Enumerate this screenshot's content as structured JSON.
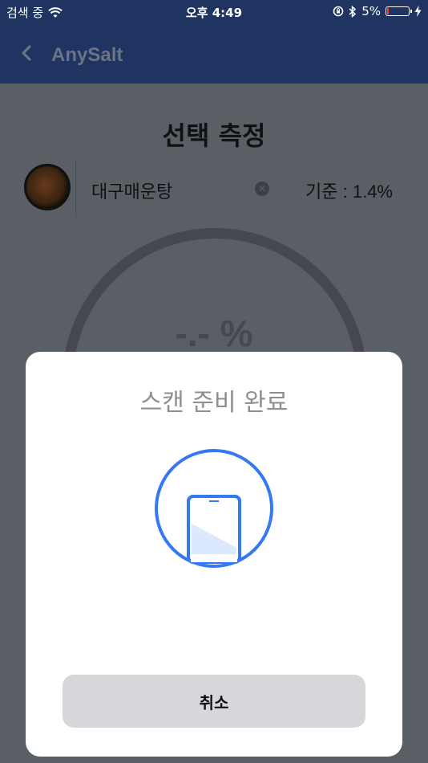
{
  "status_bar": {
    "carrier": "검색 중",
    "time": "오후 4:49",
    "battery_percent": "5%"
  },
  "nav": {
    "title": "AnySalt"
  },
  "page": {
    "title": "선택 측정",
    "food": {
      "name": "대구매운탕",
      "standard": "기준 : 1.4%"
    },
    "gauge": {
      "value": "-.- %"
    }
  },
  "modal": {
    "title": "스캔 준비 완료",
    "cancel_label": "취소"
  },
  "colors": {
    "nav_bg": "#1f3461",
    "accent_blue": "#3478f6",
    "battery_low": "#ff3b30",
    "button_bg": "#d6d6db"
  },
  "icons": [
    "wifi-icon",
    "orientation-lock-icon",
    "bluetooth-icon",
    "battery-icon",
    "charging-icon",
    "back-chevron-icon",
    "clear-icon",
    "phone-scan-icon"
  ]
}
